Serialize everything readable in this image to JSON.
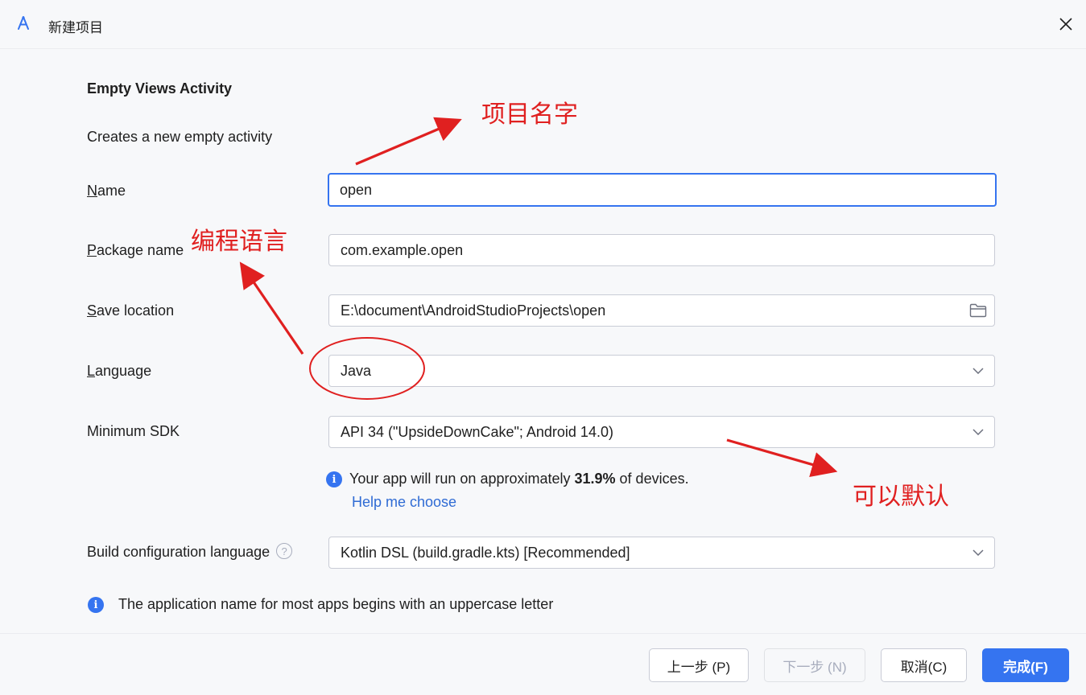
{
  "window": {
    "title": "新建项目",
    "icon": "android-studio-icon",
    "close_icon": "close-icon"
  },
  "form": {
    "heading": "Empty Views Activity",
    "subtitle": "Creates a new empty activity",
    "name": {
      "mnemonic": "N",
      "label_rest": "ame",
      "value": "open"
    },
    "package": {
      "mnemonic": "P",
      "label_rest": "ackage name",
      "value": "com.example.open"
    },
    "save_location": {
      "mnemonic": "S",
      "label_rest": "ave location",
      "value": "E:\\document\\AndroidStudioProjects\\open",
      "icon": "folder-icon"
    },
    "language": {
      "mnemonic": "L",
      "label_rest": "anguage",
      "value": "Java"
    },
    "min_sdk": {
      "label": "Minimum SDK",
      "value": "API 34 (\"UpsideDownCake\"; Android 14.0)"
    },
    "sdk_info": {
      "prefix": "Your app will run on approximately ",
      "percent": "31.9%",
      "suffix": " of devices.",
      "help_link": "Help me choose"
    },
    "build_config": {
      "label": "Build configuration language",
      "help_icon": "?",
      "value": "Kotlin DSL (build.gradle.kts) [Recommended]"
    },
    "hint": "The application name for most apps begins with an uppercase letter",
    "info_glyph": "i"
  },
  "footer": {
    "previous": "上一步 (P)",
    "next": "下一步 (N)",
    "cancel": "取消(C)",
    "finish": "完成(F)"
  },
  "annotations": {
    "project_name": "项目名字",
    "programming_language": "编程语言",
    "can_default": "可以默认",
    "color": "#e02020"
  },
  "colors": {
    "accent": "#3574f0",
    "link": "#2f6bd4",
    "background": "#f7f8fa"
  }
}
